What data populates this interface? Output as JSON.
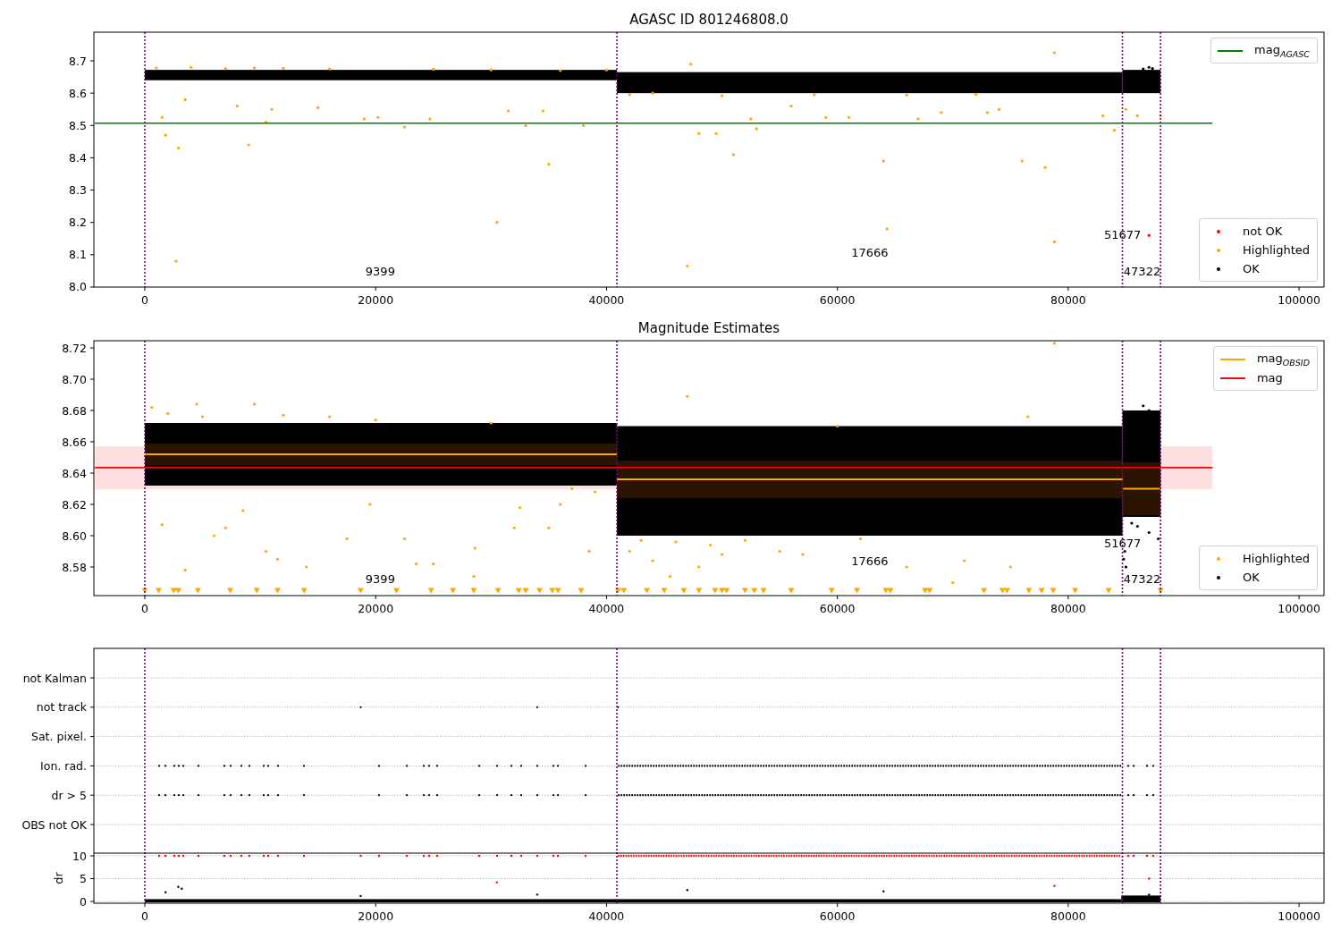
{
  "figure": {
    "panels": [
      {
        "kind": "magnitude",
        "title": "AGASC ID 801246808.0",
        "y_ticks": [
          "8.7",
          "8.6",
          "8.5",
          "8.4",
          "8.3",
          "8.2",
          "8.1",
          "8.0"
        ],
        "x_ticks": [
          "0",
          "20000",
          "40000",
          "60000",
          "80000",
          "100000"
        ],
        "labels": [
          "9399",
          "17666",
          "51677",
          "47322"
        ],
        "legends": [
          {
            "entries": [
              {
                "kind": "line",
                "label": "mag$_{AGASC}$",
                "color": "#008000"
              }
            ]
          },
          {
            "entries": [
              {
                "kind": "dot",
                "label": "not OK",
                "color": "#ff0000"
              },
              {
                "kind": "dot",
                "label": "Highlighted",
                "color": "#ffa500"
              },
              {
                "kind": "dot",
                "label": "OK",
                "color": "#000000"
              }
            ]
          }
        ]
      },
      {
        "kind": "magnitude",
        "title": "Magnitude Estimates",
        "y_ticks": [
          "8.72",
          "8.70",
          "8.68",
          "8.66",
          "8.64",
          "8.62",
          "8.60",
          "8.58"
        ],
        "x_ticks": [
          "0",
          "20000",
          "40000",
          "60000",
          "80000",
          "100000"
        ],
        "labels": [
          "9399",
          "17666",
          "51677",
          "47322"
        ],
        "legends": [
          {
            "entries": [
              {
                "kind": "line",
                "label": "mag$_{OBSID}$",
                "color": "#ffa500"
              },
              {
                "kind": "line",
                "label": "mag",
                "color": "#ff0000"
              }
            ]
          },
          {
            "entries": [
              {
                "kind": "dot",
                "label": "Highlighted",
                "color": "#ffa500"
              },
              {
                "kind": "dot",
                "label": "OK",
                "color": "#000000"
              }
            ]
          }
        ]
      },
      {
        "kind": "flags",
        "categories": [
          "not Kalman",
          "not track",
          "Sat. pixel.",
          "Ion. rad.",
          "dr > 5",
          "OBS not OK"
        ],
        "dr_axis": {
          "label": "dr",
          "ticks": [
            "10",
            "5",
            "0"
          ]
        },
        "x_ticks": [
          "0",
          "20000",
          "40000",
          "60000",
          "80000",
          "100000"
        ]
      }
    ]
  }
}
